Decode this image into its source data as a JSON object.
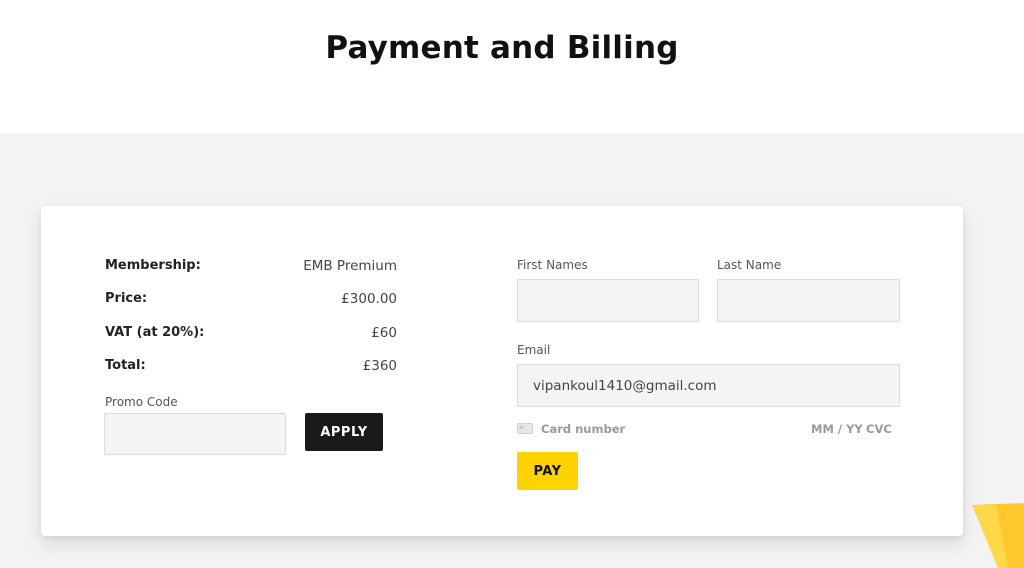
{
  "page": {
    "title": "Payment and Billing"
  },
  "summary": [
    {
      "label": "Membership:",
      "value": "EMB Premium"
    },
    {
      "label": "Price:",
      "value": "£300.00"
    },
    {
      "label": "VAT (at 20%):",
      "value": "£60"
    },
    {
      "label": "Total:",
      "value": "£360"
    }
  ],
  "promo": {
    "label": "Promo Code",
    "value": "",
    "apply_label": "APPLY"
  },
  "form": {
    "first_name_label": "First Names",
    "first_name_value": "",
    "last_name_label": "Last Name",
    "last_name_value": "",
    "email_label": "Email",
    "email_value": "vipankoul1410@gmail.com",
    "card_number_placeholder": "Card number",
    "expiry_placeholder": "MM / YY",
    "cvc_placeholder": "CVC",
    "card_icon": "credit-card-icon",
    "pay_label": "PAY"
  },
  "colors": {
    "accent": "#ffd300",
    "apply_button": "#1a1a1a",
    "content_background": "#f3f3f3",
    "input_background": "#f4f4f4"
  }
}
